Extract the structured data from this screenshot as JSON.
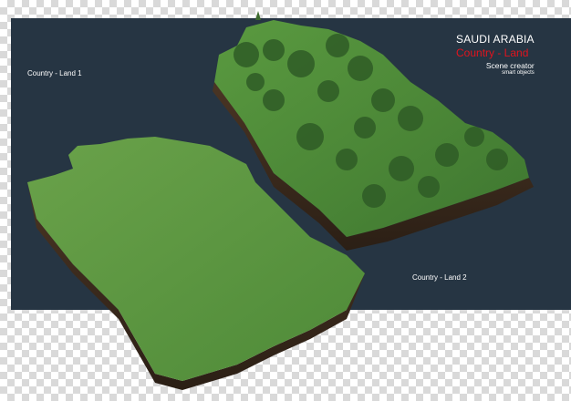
{
  "title": {
    "country": "SAUDI ARABIA",
    "subtitle": "Country - Land",
    "scene_creator": "Scene creator",
    "smart_objects": "smart objects"
  },
  "labels": {
    "land1": "Country - Land 1",
    "land2": "Country - Land 2"
  },
  "colors": {
    "panel": "#263543",
    "grass": "#4f8a3a",
    "soil": "#3a2a1c",
    "accent_red": "#e0141e"
  },
  "icons": [
    "transparency-checkerboard",
    "tree-canopy",
    "grass-terrain"
  ]
}
